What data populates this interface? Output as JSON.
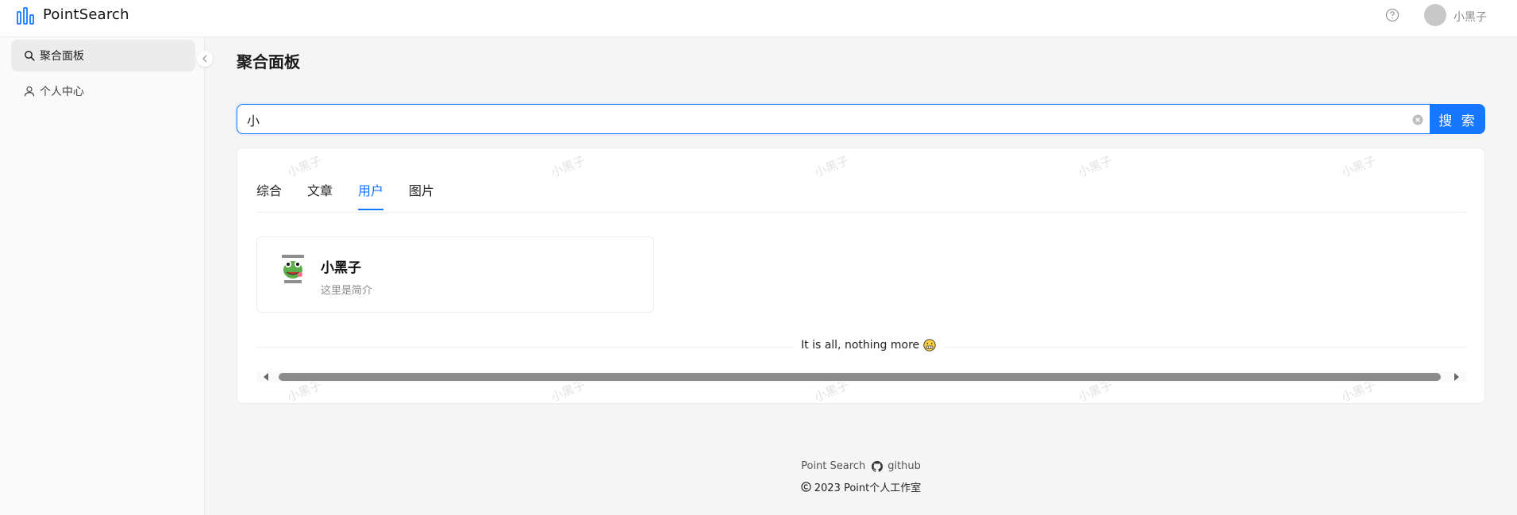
{
  "header": {
    "app_title": "PointSearch",
    "username": "小黑子",
    "logo_icon": "bar-chart-icon",
    "help_icon": "question-circle-icon"
  },
  "sidebar": {
    "items": [
      {
        "label": "聚合面板",
        "icon": "search-icon",
        "active": true
      },
      {
        "label": "个人中心",
        "icon": "user-icon",
        "active": false
      }
    ]
  },
  "main": {
    "page_title": "聚合面板",
    "search": {
      "value": "小",
      "button_label": "搜 索"
    },
    "tabs": [
      {
        "label": "综合",
        "active": false
      },
      {
        "label": "文章",
        "active": false
      },
      {
        "label": "用户",
        "active": true
      },
      {
        "label": "图片",
        "active": false
      }
    ],
    "results": [
      {
        "name": "小黑子",
        "bio": "这里是简介"
      }
    ],
    "end_text": "It is all, nothing more",
    "watermark": "小黑子"
  },
  "footer": {
    "project_name": "Point Search",
    "github_label": "github",
    "copyright": "2023 Point个人工作室"
  },
  "colors": {
    "accent": "#1677ff",
    "background": "#f5f5f5"
  }
}
